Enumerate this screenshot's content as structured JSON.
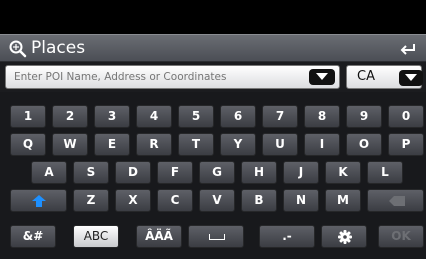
{
  "title": "Places",
  "search": {
    "placeholder": "Enter POI Name, Address or Coordinates"
  },
  "country": {
    "value": "CA"
  },
  "keyboard": {
    "row1": [
      "1",
      "2",
      "3",
      "4",
      "5",
      "6",
      "7",
      "8",
      "9",
      "0"
    ],
    "row2": [
      "Q",
      "W",
      "E",
      "R",
      "T",
      "Y",
      "U",
      "I",
      "O",
      "P"
    ],
    "row3": [
      "A",
      "S",
      "D",
      "F",
      "G",
      "H",
      "J",
      "K",
      "L"
    ],
    "row4": [
      "Z",
      "X",
      "C",
      "V",
      "B",
      "N",
      "M"
    ],
    "symbols_label": "&#",
    "abc_label": "ABC",
    "accents_label": "ÂÄÃ",
    "dash_label": ".-",
    "ok_label": "OK"
  },
  "icons": {
    "search": "search-icon",
    "back": "back-icon",
    "shift": "shift-arrow-icon",
    "backspace": "backspace-icon",
    "space": "space-icon",
    "settings": "gear-icon"
  },
  "colors": {
    "shift_arrow": "#1e90ff",
    "key_text": "#ffffff"
  }
}
